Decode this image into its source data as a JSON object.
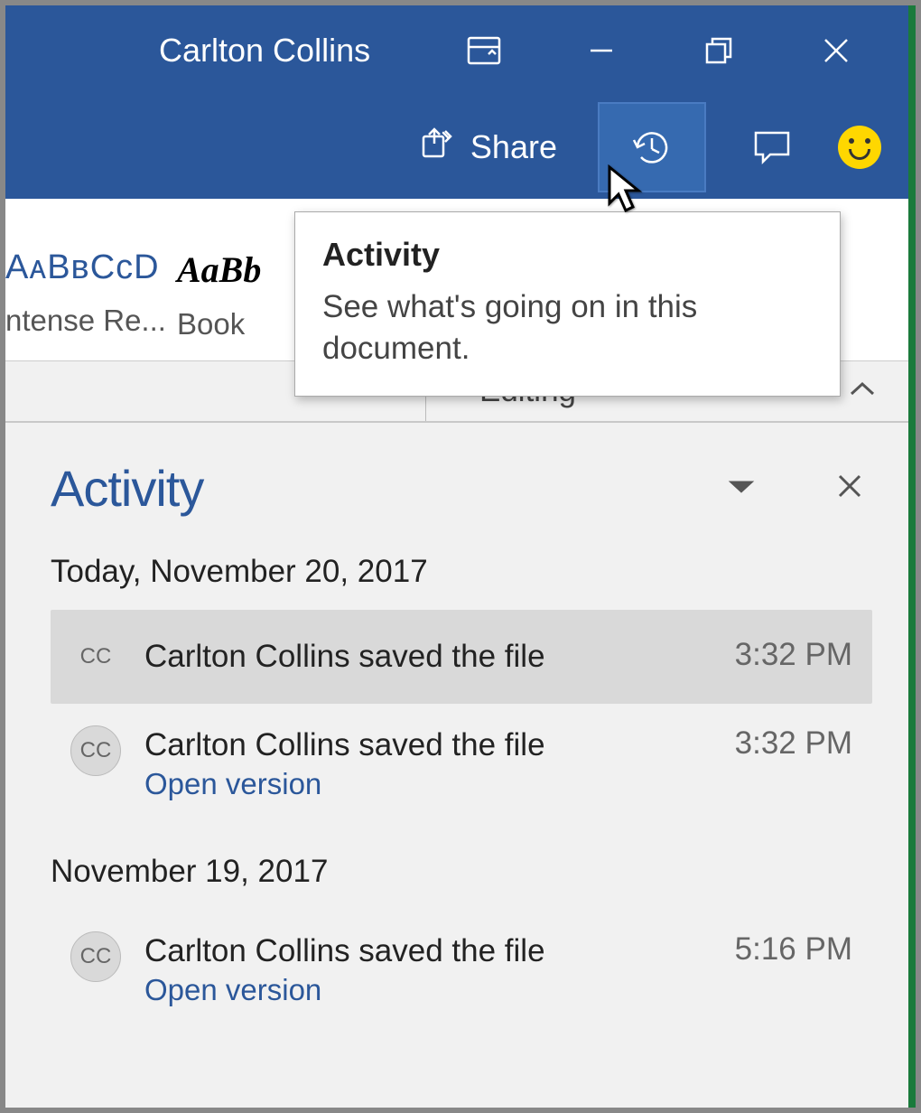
{
  "titlebar": {
    "user_name": "Carlton Collins"
  },
  "ribbon": {
    "share_label": "Share",
    "styles": [
      {
        "preview": "AᴀBʙCᴄD",
        "label": "ntense Re..."
      },
      {
        "preview": "AaBb",
        "label": "Book "
      }
    ],
    "mode_label": "Editing"
  },
  "tooltip": {
    "title": "Activity",
    "description": "See what's going on in this document."
  },
  "pane": {
    "title": "Activity",
    "groups": [
      {
        "date_label": "Today, November 20, 2017",
        "items": [
          {
            "initials": "CC",
            "action": "Carlton Collins saved the file",
            "time": "3:32 PM",
            "selected": true,
            "open_link": null
          },
          {
            "initials": "CC",
            "action": "Carlton Collins saved the file",
            "time": "3:32 PM",
            "selected": false,
            "open_link": "Open version"
          }
        ]
      },
      {
        "date_label": "November 19, 2017",
        "items": [
          {
            "initials": "CC",
            "action": "Carlton Collins saved the file",
            "time": "5:16 PM",
            "selected": false,
            "open_link": "Open version"
          }
        ]
      }
    ]
  }
}
